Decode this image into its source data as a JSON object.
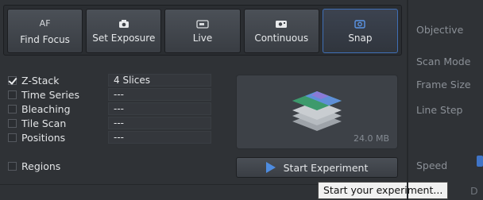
{
  "toolbar": {
    "buttons": [
      {
        "top": "AF",
        "label": "Find Focus"
      },
      {
        "label": "Set Exposure",
        "icon": "camera-icon"
      },
      {
        "label": "Live",
        "icon": "live-camera-icon"
      },
      {
        "label": "Continuous",
        "icon": "continuous-camera-icon"
      },
      {
        "label": "Snap",
        "icon": "snap-camera-icon"
      }
    ]
  },
  "experiment_options": [
    {
      "label": "Z-Stack",
      "checked": true,
      "value": "4 Slices"
    },
    {
      "label": "Time Series",
      "checked": false,
      "value": "---"
    },
    {
      "label": "Bleaching",
      "checked": false,
      "value": "---"
    },
    {
      "label": "Tile Scan",
      "checked": false,
      "value": "---"
    },
    {
      "label": "Positions",
      "checked": false,
      "value": "---"
    },
    {
      "label": "Regions",
      "checked": false,
      "value": ""
    }
  ],
  "preview": {
    "size": "24.0 MB"
  },
  "start_button": {
    "label": "Start Experiment"
  },
  "tooltip": {
    "text": "Start your experiment..."
  },
  "right_panel": {
    "labels": [
      "Objective",
      "Scan Mode",
      "Frame Size",
      "Line Step",
      "Speed"
    ],
    "fragment": "D"
  },
  "colors": {
    "accent": "#4e8ce0",
    "snap_border": "#3f6fb6"
  }
}
